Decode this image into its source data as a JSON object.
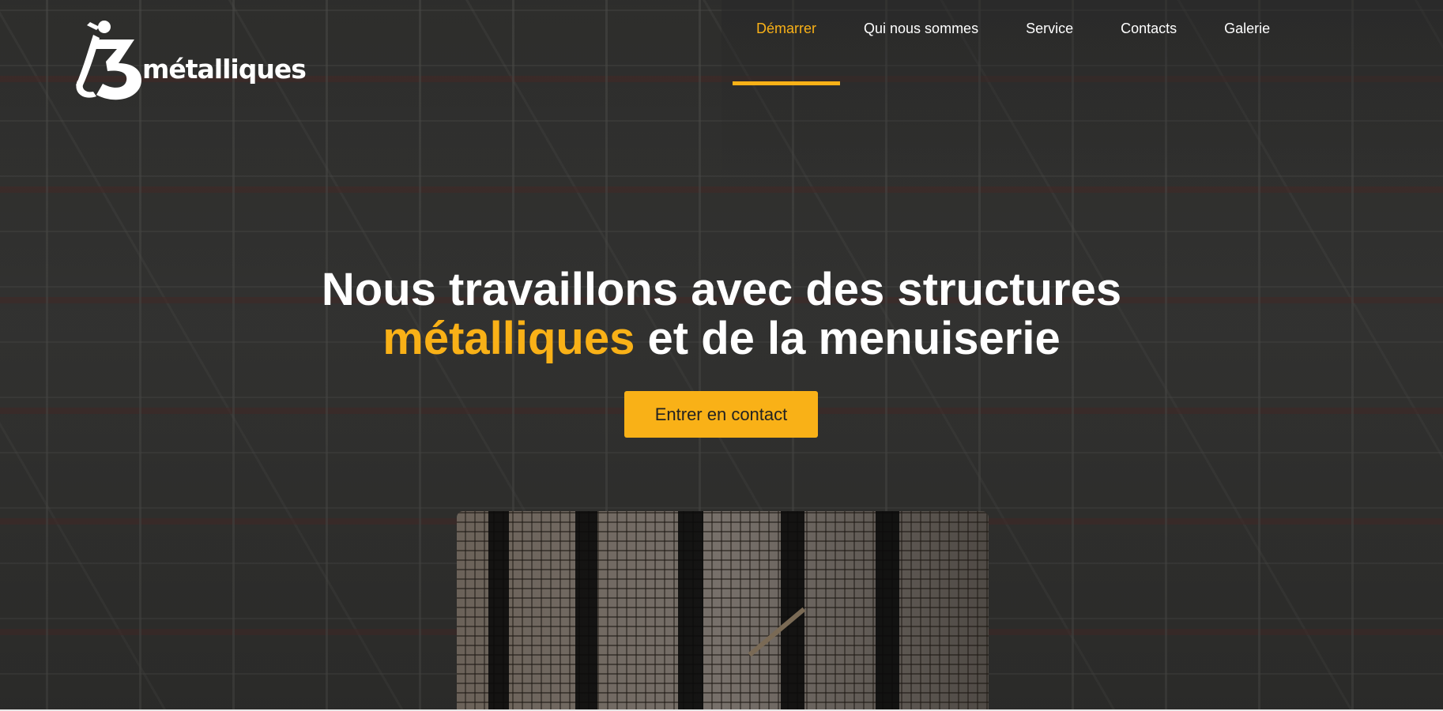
{
  "brand": {
    "logo_text": "métalliques",
    "accent_color": "#f9b117"
  },
  "nav": {
    "items": [
      {
        "label": "Démarrer",
        "active": true
      },
      {
        "label": "Qui nous sommes",
        "active": false
      },
      {
        "label": "Service",
        "active": false
      },
      {
        "label": "Contacts",
        "active": false
      },
      {
        "label": "Galerie",
        "active": false
      }
    ]
  },
  "hero": {
    "headline_line1": "Nous travaillons avec des structures",
    "headline_accent": "métalliques",
    "headline_line2_rest": " et de la menuiserie",
    "cta_label": "Entrer en contact",
    "background_icon": "scaffolding-photo",
    "feature_icon": "rebar-mesh-photo"
  }
}
